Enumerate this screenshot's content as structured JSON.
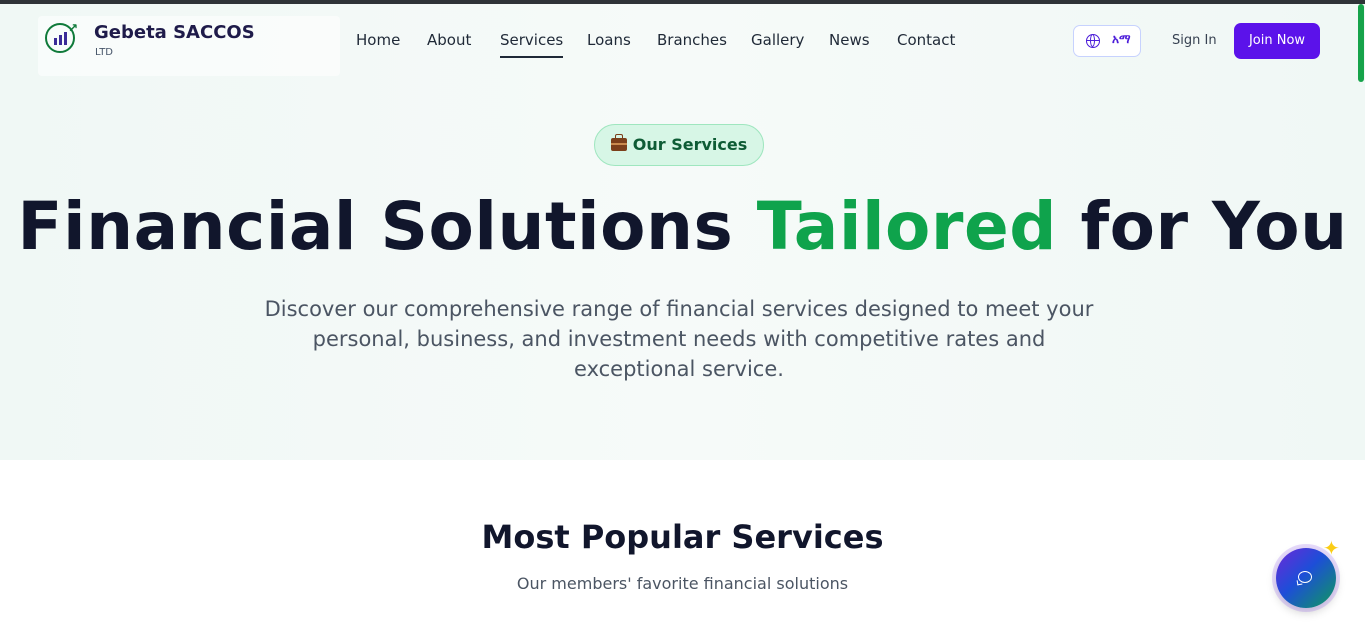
{
  "brand": {
    "name": "Gebeta SACCOS",
    "subtitle": "LTD",
    "logo_icon": "growth-chart-logo"
  },
  "nav": {
    "items": [
      {
        "label": "Home",
        "active": false
      },
      {
        "label": "About",
        "active": false
      },
      {
        "label": "Services",
        "active": true
      },
      {
        "label": "Loans",
        "active": false
      },
      {
        "label": "Branches",
        "active": false
      },
      {
        "label": "Gallery",
        "active": false
      },
      {
        "label": "News",
        "active": false
      },
      {
        "label": "Contact",
        "active": false
      }
    ]
  },
  "header_actions": {
    "language_icon": "globe-icon",
    "language_label": "አማ",
    "sign_in": "Sign In",
    "join": "Join Now"
  },
  "hero": {
    "badge_icon": "briefcase-icon",
    "badge": "Our Services",
    "title_part1": "Financial Solutions ",
    "title_accent": "Tailored",
    "title_part2": " for You",
    "description": "Discover our comprehensive range of financial services designed to meet your personal, business, and investment needs with competitive rates and exceptional service."
  },
  "popular": {
    "title": "Most Popular Services",
    "subtitle": "Our members' favorite financial solutions"
  },
  "chat": {
    "icon": "chat-bubble-icon",
    "sparkle_icon": "sparkle-icon"
  },
  "colors": {
    "primary": "#5b12ea",
    "accent_green": "#0fa34c",
    "heading": "#11162c",
    "badge_bg": "#d7f6e6",
    "badge_text": "#0e5c35"
  }
}
